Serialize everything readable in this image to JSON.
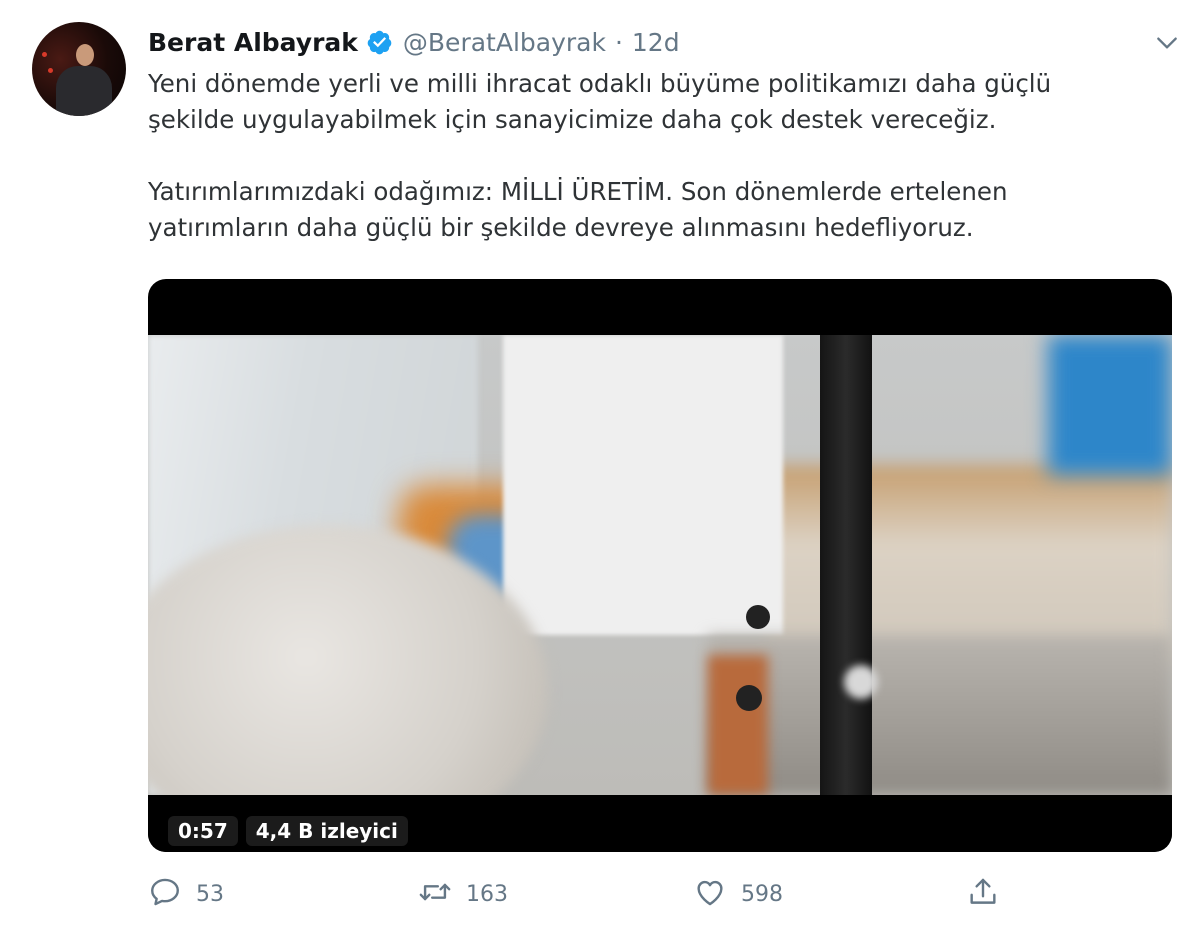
{
  "tweet": {
    "author_name": "Berat Albayrak",
    "handle": "@BeratAlbayrak",
    "separator": "·",
    "time": "12d",
    "text_lines": [
      "Yeni dönemde yerli ve milli ihracat odaklı büyüme politikamızı daha güçlü",
      "şekilde uygulayabilmek için sanayicimize daha çok destek vereceğiz.",
      "",
      "Yatırımlarımızdaki odağımız: MİLLİ ÜRETİM. Son dönemlerde ertelenen",
      "yatırımların daha güçlü bir şekilde devreye alınmasını hedefliyoruz."
    ]
  },
  "video": {
    "duration": "0:57",
    "views": "4,4 B izleyici"
  },
  "actions": {
    "replies": "53",
    "retweets": "163",
    "likes": "598"
  },
  "icons": {
    "verified": "verified-badge-icon",
    "more": "chevron-down-icon",
    "reply": "reply-icon",
    "retweet": "retweet-icon",
    "like": "heart-icon",
    "share": "share-icon"
  },
  "colors": {
    "verified_blue": "#1da1f2",
    "secondary_text": "#657786",
    "primary_text": "#14171a"
  }
}
